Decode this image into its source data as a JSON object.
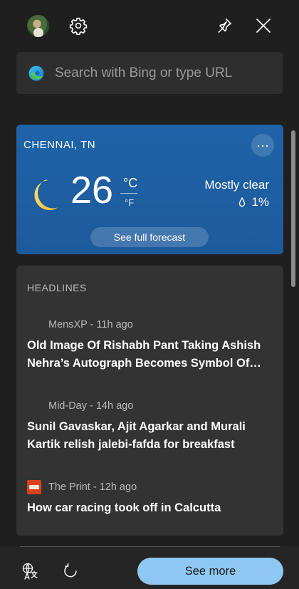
{
  "search": {
    "placeholder": "Search with Bing or type URL"
  },
  "weather": {
    "location": "CHENNAI, TN",
    "temperature": "26",
    "unit_primary": "°C",
    "unit_secondary": "°F",
    "condition": "Mostly clear",
    "precipitation": "1%",
    "more_label": "···",
    "forecast_button": "See full forecast",
    "condition_icon": "crescent-moon-icon"
  },
  "headlines": {
    "title": "HEADLINES",
    "items": [
      {
        "source_meta": "MensXP - 11h ago",
        "title": "Old Image Of Rishabh Pant Taking Ashish Nehra’s Autograph Becomes Symbol Of…"
      },
      {
        "source_meta": "Mid-Day - 14h ago",
        "title": "Sunil Gavaskar, Ajit Agarkar and Murali Kartik relish jalebi-fafda for breakfast"
      },
      {
        "source_meta": "The Print - 12h ago",
        "title": "How car racing took off in Calcutta"
      }
    ]
  },
  "footer": {
    "see_more_label": "See more"
  },
  "colors": {
    "background": "#1f1f1f",
    "weather_card": "#1f63a8",
    "headlines_card": "#333333",
    "see_more_button": "#8ec8f2"
  }
}
